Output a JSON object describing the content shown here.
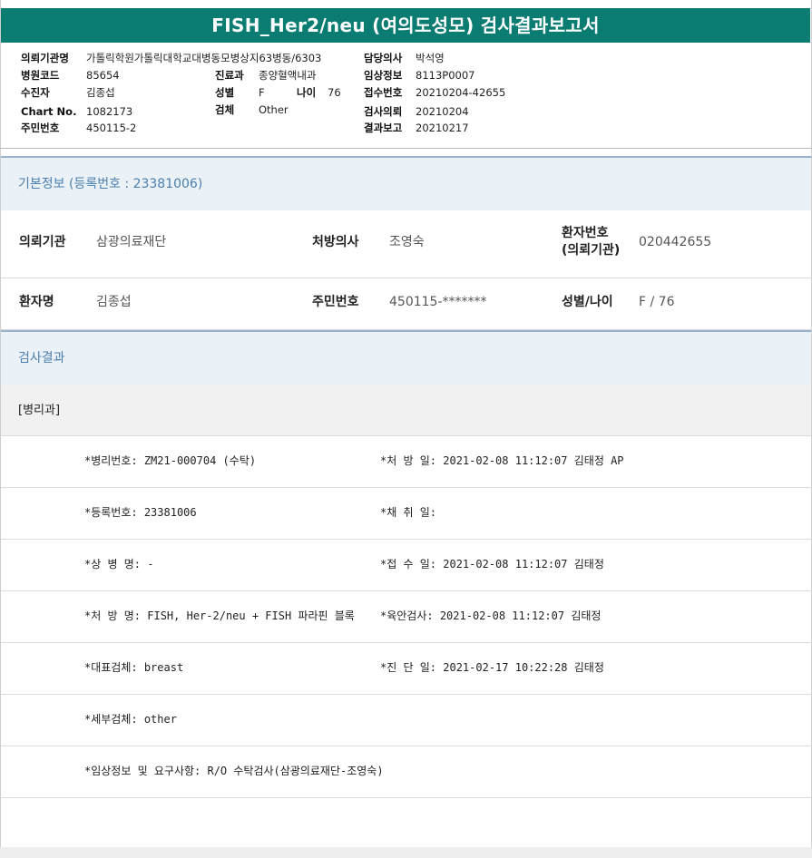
{
  "report_title": "FISH_Her2/neu (여의도성모) 검사결과보고서",
  "header": {
    "left": [
      {
        "label": "의뢰기관명",
        "value": "가톨릭학원가톨릭대학교대병동모병상지63병동/6303"
      },
      {
        "label": "병원코드",
        "value": "85654"
      },
      {
        "label": "수진자",
        "value": "김종섭"
      },
      {
        "label": "Chart No.",
        "value": "1082173"
      },
      {
        "label": "주민번호",
        "value": "450115-2"
      }
    ],
    "middle": [
      {
        "label": "진료과",
        "value": "종양혈액내과"
      },
      {
        "label": "성별",
        "value": "F"
      },
      {
        "label": "검체",
        "value": "Other"
      }
    ],
    "age": {
      "label": "나이",
      "value": "76"
    },
    "right": [
      {
        "label": "담당의사",
        "value": "박석영"
      },
      {
        "label": "임상정보",
        "value": "8113P0007"
      },
      {
        "label": "접수번호",
        "value": "20210204-42655"
      },
      {
        "label": "검사의뢰",
        "value": "20210204"
      },
      {
        "label": "결과보고",
        "value": "20210217"
      }
    ]
  },
  "basic_info": {
    "heading": "기본정보",
    "reg_text": "(등록번호 : 23381006)",
    "rows": [
      {
        "c1_label": "의뢰기관",
        "c1_value": "삼광의료재단",
        "c2_label": "처방의사",
        "c2_value": "조영숙",
        "c3_label_line1": "환자번호",
        "c3_label_line2": "(의뢰기관)",
        "c3_value": "020442655"
      },
      {
        "c1_label": "환자명",
        "c1_value": "김종섭",
        "c2_label": "주민번호",
        "c2_value": "450115-*******",
        "c3_label": "성별/나이",
        "c3_value": "F / 76"
      }
    ]
  },
  "results": {
    "heading": "검사결과",
    "department": "[병리과]",
    "rows": [
      {
        "left": "*병리번호: ZM21-000704 (수탁)",
        "right": "*처 방 일: 2021-02-08 11:12:07  김태정 AP"
      },
      {
        "left": "*등록번호: 23381006",
        "right": "*채 취 일:"
      },
      {
        "left": "*상 병 명: -",
        "right": "*접 수 일: 2021-02-08 11:12:07  김태정"
      },
      {
        "left": "*처 방 명: FISH, Her-2/neu + FISH 파라핀 블록",
        "right": "*육안검사: 2021-02-08 11:12:07  김태정"
      },
      {
        "left": "*대표검체: breast",
        "right": "*진 단 일: 2021-02-17 10:22:28  김태정"
      },
      {
        "left": "*세부검체: other",
        "right": ""
      },
      {
        "left": "*임상정보 및 요구사항: R/O 수탁검사(삼광의료재단-조영숙)",
        "right": ""
      }
    ]
  }
}
